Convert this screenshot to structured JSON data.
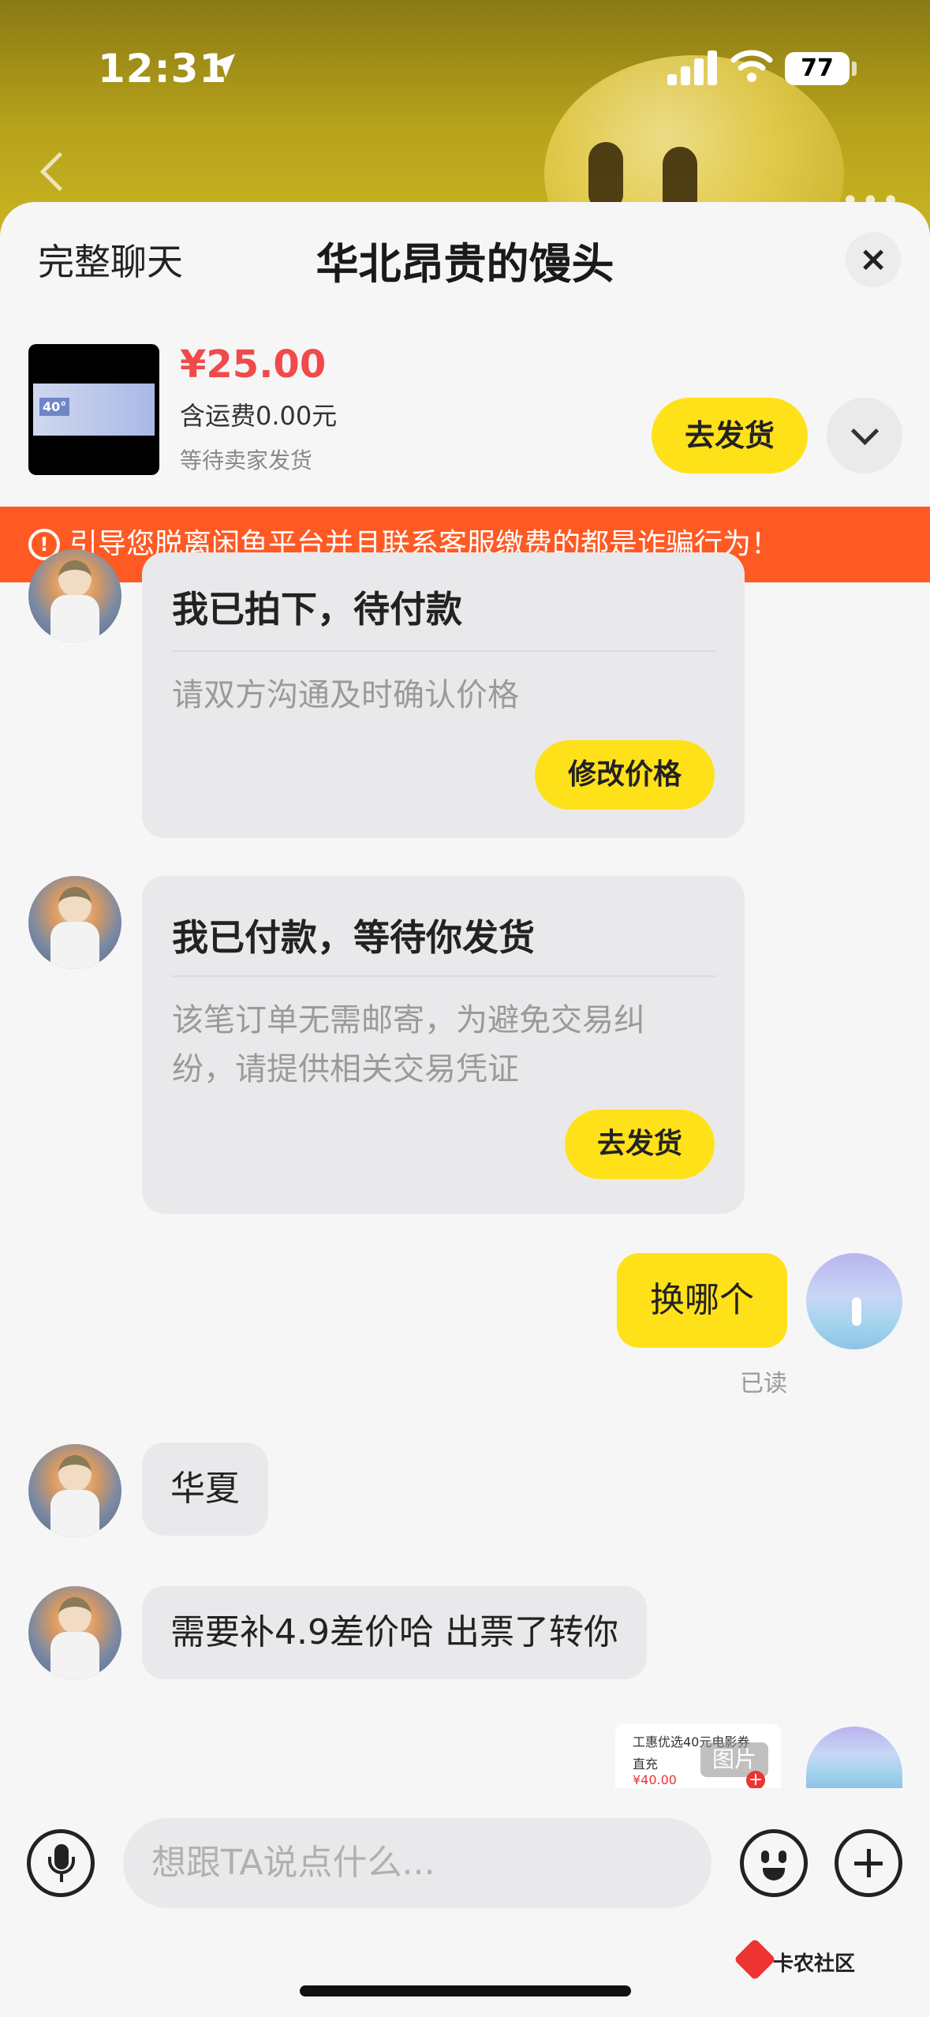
{
  "status": {
    "time": "12:31",
    "battery": "77"
  },
  "header": {
    "left_label": "完整聊天",
    "title": "华北昂贵的馒头",
    "close": "×"
  },
  "product": {
    "price": "¥25.00",
    "shipping": "含运费0.00元",
    "status": "等待卖家发货",
    "ship_button": "去发货",
    "thumb_badge": "40°"
  },
  "warning": {
    "text": "引导您脱离闲鱼平台并且联系客服缴费的都是诈骗行为！"
  },
  "messages": {
    "card1": {
      "title": "我已拍下，待付款",
      "desc": "请双方沟通及时确认价格",
      "button": "修改价格"
    },
    "card2": {
      "title": "我已付款，等待你发货",
      "desc": "该笔订单无需邮寄，为避免交易纠纷，请提供相关交易凭证",
      "button": "去发货"
    },
    "me1": {
      "text": "换哪个",
      "status": "已读"
    },
    "other1": {
      "text": "华夏"
    },
    "other2": {
      "text": "需要补4.9差价哈 出票了转你"
    },
    "image": {
      "line1": "工惠优选40元电影券",
      "line2": "直充",
      "price": "¥40.00",
      "tag": "图片"
    }
  },
  "input": {
    "placeholder": "想跟TA说点什么..."
  },
  "watermark": {
    "text": "卡农社区"
  },
  "icons": [
    "location-arrow-icon",
    "signal-icon",
    "wifi-icon",
    "battery-icon",
    "back-chevron-icon",
    "more-icon",
    "close-icon",
    "chevron-down-icon",
    "warning-icon",
    "mic-icon",
    "emoji-icon",
    "plus-icon"
  ],
  "colors": {
    "accent": "#ffe11a",
    "price": "#f04a4a",
    "warning": "#ff5a24"
  }
}
